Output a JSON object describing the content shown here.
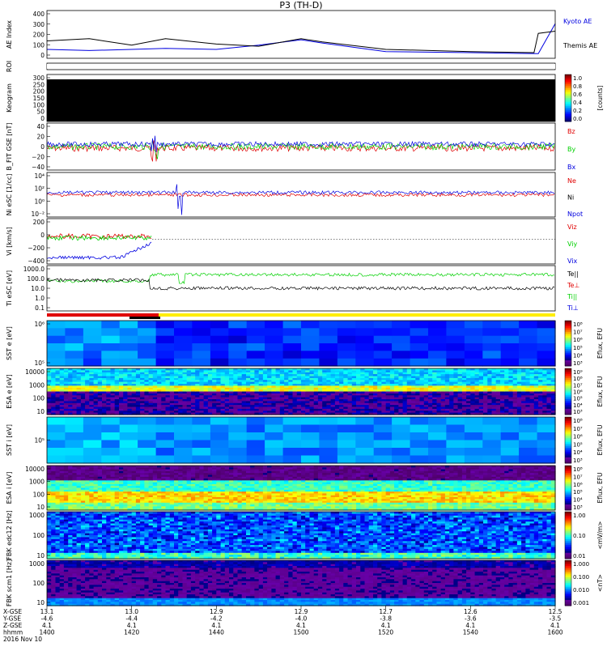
{
  "title": "P3 (TH-D)",
  "colors": {
    "red": "#e00000",
    "green": "#00d000",
    "blue": "#0000e0",
    "black": "#000000",
    "yellow": "#ffee00"
  },
  "chart_data": [
    {
      "id": "ae",
      "type": "line",
      "ylabel": "AE Index",
      "ytick_labels": [
        "400",
        "300",
        "200",
        "100",
        "0"
      ],
      "legend": [
        "Kyoto AE",
        "Themis AE"
      ],
      "series": [
        {
          "name": "Kyoto AE",
          "color": "#0000e0",
          "x": [
            1400,
            1410,
            1420,
            1428,
            1440,
            1450,
            1500,
            1505,
            1520,
            1540,
            1556,
            1560
          ],
          "values": [
            60,
            50,
            60,
            70,
            60,
            100,
            150,
            120,
            40,
            30,
            20,
            300
          ]
        },
        {
          "name": "Themis AE",
          "color": "#000000",
          "x": [
            1400,
            1410,
            1420,
            1428,
            1440,
            1450,
            1500,
            1505,
            1520,
            1540,
            1555,
            1556,
            1560
          ],
          "values": [
            140,
            160,
            100,
            160,
            110,
            90,
            160,
            130,
            60,
            40,
            30,
            210,
            230
          ]
        }
      ]
    },
    {
      "id": "roi",
      "type": "line",
      "ylabel": "ROI"
    },
    {
      "id": "keogram",
      "type": "heatmap",
      "ylabel": "Keogram",
      "ytick_labels": [
        "300",
        "250",
        "200",
        "150",
        "100",
        "50",
        "0"
      ],
      "colorbar_label": "[counts]",
      "colorbar_ticks": [
        "1.0",
        "0.8",
        "0.6",
        "0.4",
        "0.2",
        "0.0"
      ]
    },
    {
      "id": "bfield",
      "type": "line",
      "ylabel": "B_FIT GSE [nT]",
      "ytick_labels": [
        "40",
        "20",
        "0",
        "−20",
        "−40"
      ],
      "legend": [
        "Bz",
        "By",
        "Bx"
      ],
      "legend_colors": [
        "#e00000",
        "#00d000",
        "#0000e0"
      ]
    },
    {
      "id": "density",
      "type": "line",
      "ylabel": "Ni eSC [1/cc]",
      "ytick_labels": [
        "10⁴",
        "10²",
        "10⁰",
        "10⁻²"
      ],
      "legend": [
        "Ne",
        "Ni",
        "Npot"
      ],
      "legend_colors": [
        "#e00000",
        "#000000",
        "#0000e0"
      ]
    },
    {
      "id": "velocity",
      "type": "line",
      "ylabel": "Vi [km/s]",
      "ytick_labels": [
        "200",
        "0",
        "−200",
        "−400"
      ],
      "legend": [
        "Viz",
        "Viy",
        "Vix"
      ],
      "legend_colors": [
        "#e00000",
        "#00d000",
        "#0000e0"
      ]
    },
    {
      "id": "temperature",
      "type": "line",
      "ylabel": "Ti eSC [eV]",
      "ytick_labels": [
        "1000.0",
        "100.0",
        "10.0",
        "1.0",
        "0.1"
      ],
      "legend": [
        "Te||",
        "Te⊥",
        "Ti||",
        "Ti⊥"
      ],
      "legend_colors": [
        "#000000",
        "#e00000",
        "#00d000",
        "#0000e0"
      ]
    },
    {
      "id": "sst_e",
      "type": "heatmap",
      "ylabel": "SST e [eV]",
      "ytick_labels": [
        "10⁶",
        "10⁵"
      ],
      "colorbar_label": "Eflux, EFU",
      "colorbar_ticks": [
        "10⁸",
        "10⁷",
        "10⁶",
        "10⁵",
        "10⁴",
        "10³"
      ]
    },
    {
      "id": "esa_e",
      "type": "heatmap",
      "ylabel": "ESA e [eV]",
      "ytick_labels": [
        "10000",
        "1000",
        "100",
        "10"
      ],
      "colorbar_label": "Eflux, EFU",
      "colorbar_ticks": [
        "10⁹",
        "10⁸",
        "10⁷",
        "10⁶",
        "10⁵",
        "10⁴",
        "10³"
      ]
    },
    {
      "id": "sst_i",
      "type": "heatmap",
      "ylabel": "SST i [eV]",
      "ytick_labels": [
        "10⁵"
      ],
      "colorbar_label": "Eflux, EFU",
      "colorbar_ticks": [
        "10⁸",
        "10⁷",
        "10⁶",
        "10⁵",
        "10⁴",
        "10³"
      ]
    },
    {
      "id": "esa_i",
      "type": "heatmap",
      "ylabel": "ESA i [eV]",
      "ytick_labels": [
        "10000",
        "1000",
        "100",
        "10"
      ],
      "colorbar_label": "Eflux, EFU",
      "colorbar_ticks": [
        "10⁸",
        "10⁷",
        "10⁶",
        "10⁵",
        "10⁴",
        "10³"
      ]
    },
    {
      "id": "fbk_e",
      "type": "heatmap",
      "ylabel": "FBK edc12 [Hz]",
      "ytick_labels": [
        "1000",
        "100",
        "10"
      ],
      "colorbar_label": "<mV/m>",
      "colorbar_ticks": [
        "1.00",
        "0.10",
        "0.01"
      ]
    },
    {
      "id": "fbk_b",
      "type": "heatmap",
      "ylabel": "FBK scm1 [Hz]",
      "ytick_labels": [
        "1000",
        "100",
        "10"
      ],
      "colorbar_label": "<nT>",
      "colorbar_ticks": [
        "1.000",
        "0.100",
        "0.010",
        "0.001"
      ]
    }
  ],
  "xaxis": {
    "row_labels": [
      "X-GSE",
      "Y-GSE",
      "Z-GSE",
      "hhmm",
      "2016 Nov 10"
    ],
    "columns": [
      {
        "x": "13.1",
        "y": "-4.6",
        "z": "4.1",
        "t": "1400"
      },
      {
        "x": "13.0",
        "y": "-4.4",
        "z": "4.1",
        "t": "1420"
      },
      {
        "x": "12.9",
        "y": "-4.2",
        "z": "4.1",
        "t": "1440"
      },
      {
        "x": "12.9",
        "y": "-4.0",
        "z": "4.1",
        "t": "1500"
      },
      {
        "x": "12.7",
        "y": "-3.8",
        "z": "4.1",
        "t": "1520"
      },
      {
        "x": "12.6",
        "y": "-3.6",
        "z": "4.1",
        "t": "1540"
      },
      {
        "x": "12.5",
        "y": "-3.5",
        "z": "4.1",
        "t": "1600"
      }
    ]
  }
}
